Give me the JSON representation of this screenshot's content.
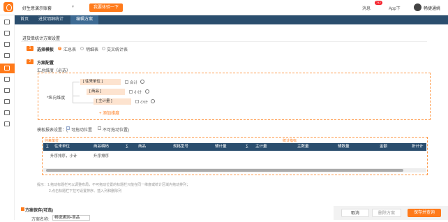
{
  "header": {
    "company": "好生意演示账套",
    "promo": "我要体验一下",
    "messages": "消息",
    "message_count": "742",
    "app": "App下",
    "user": "畅捷通姚"
  },
  "tabs": [
    "首页",
    "进货明细统计",
    "编辑方案"
  ],
  "page": {
    "title": "进货单统计方案设置"
  },
  "step1": {
    "num": "1",
    "label": "选择模板",
    "options": [
      "汇总表",
      "明细表",
      "交叉统计表"
    ]
  },
  "step2": {
    "num": "2",
    "label": "方案配置",
    "summary_label": "汇总维度（必选）",
    "vertical_label": "*纵向维度",
    "dims": [
      "[ 往来单位 ]",
      "[ 商品 ]",
      "[ 主计量 ]"
    ],
    "checks": [
      "合计",
      "小计",
      "小计"
    ],
    "add": "+ 添加维度"
  },
  "tpl": {
    "label": "模板报表设置：(",
    "movable": "可拖动位置",
    "fixed": "不可拖动位置)",
    "left_hdr": "往来单位",
    "right_hdr": "统计指标"
  },
  "columns": [
    "∑",
    "往来单位",
    "商品编码",
    "∑",
    "商品",
    "规格型号",
    "辅计量",
    "∑",
    "主计量",
    "主数量",
    "辅数量",
    "金额",
    "折计计量"
  ],
  "row": [
    "升序排序，小计",
    "升序排序"
  ],
  "tips": [
    "提示：1.拖动标题栏可以调整布局，不可拖动位置的标题栏只能在同一维度或统计区域内拖动排列；",
    "2.点击标题栏下拉可设置排序、插入列和删除列"
  ],
  "footer": {
    "save_plan": "方案保存(可选)",
    "name_label": "方案名称:",
    "name_value": "畅捷通测+商品",
    "cancel": "取消",
    "delete": "删除方案",
    "save_open": "保存并查询"
  }
}
